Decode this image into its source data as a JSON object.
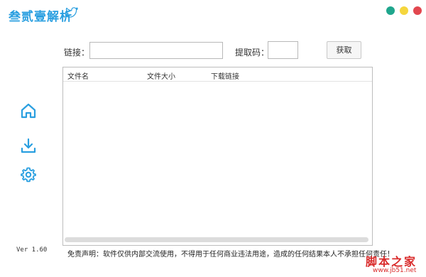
{
  "app": {
    "title": "叁贰壹解析",
    "title_icon": "bird-icon",
    "accent_color": "#2a9fe0",
    "window_buttons": [
      {
        "name": "green-dot",
        "color": "#1fa68d"
      },
      {
        "name": "yellow-dot",
        "color": "#f5d63d"
      },
      {
        "name": "red-dot",
        "color": "#e2474f"
      }
    ]
  },
  "form": {
    "link_label": "链接：",
    "link_value": "",
    "code_label": "提取码：",
    "code_value": "",
    "fetch_button": "获取"
  },
  "table": {
    "columns": [
      "文件名",
      "文件大小",
      "下载链接"
    ],
    "rows": []
  },
  "sidebar": {
    "icons": [
      "home-icon",
      "download-icon",
      "gear-icon"
    ]
  },
  "footer": {
    "version": "Ver 1.60",
    "disclaimer": "免责声明：软件仅供内部交流使用，不得用于任何商业违法用途，造成的任何结果本人不承担任何责任！"
  },
  "watermark": {
    "text": "脚本之家",
    "url": "www.jb51.net"
  }
}
